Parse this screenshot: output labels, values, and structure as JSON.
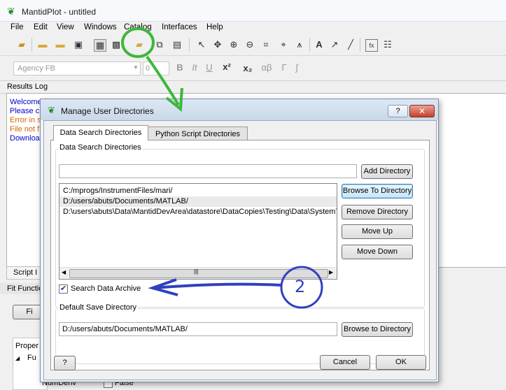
{
  "app": {
    "title": "MantidPlot - untitled"
  },
  "menu": [
    "File",
    "Edit",
    "View",
    "Windows",
    "Catalog",
    "Interfaces",
    "Help"
  ],
  "format_toolbar": {
    "font": "Agency FB",
    "size": "0"
  },
  "results_log": {
    "header": "Results Log",
    "lines": [
      {
        "text": "Welcome",
        "color": "#0000cc"
      },
      {
        "text": "Please cl",
        "color": "#0000cc"
      },
      {
        "text": "Error in s",
        "color": "#e06000"
      },
      {
        "text": "File not f",
        "color": "#e06000"
      },
      {
        "text": "Download",
        "color": "#0000cc"
      }
    ]
  },
  "side_panel": {
    "script_tab": "Script I",
    "fit_header": "Fit Functio",
    "fit_button": "Fi",
    "property_header": "Proper",
    "function_row": "Fu",
    "numderiv_label": "NumDeriv",
    "numderiv_value": "False"
  },
  "dialog": {
    "title": "Manage User Directories",
    "help_label": "?",
    "close_label": "✕",
    "tabs": [
      "Data Search Directories",
      "Python Script Directories"
    ],
    "active_tab": 0,
    "data_search_group": {
      "label": "Data Search Directories",
      "input_value": "",
      "add_button": "Add Directory",
      "directories": [
        "C:/mprogs/InstrumentFiles/mari/",
        "D:/users/abuts/Documents/MATLAB/",
        "D:\\users\\abuts\\Data\\MantidDevArea\\datastore\\DataCopies\\Testing\\Data\\SystemT"
      ],
      "selected_index": 1,
      "browse_button": "Browse To Directory",
      "remove_button": "Remove Directory",
      "move_up_button": "Move Up",
      "move_down_button": "Move Down",
      "search_archive_label": "Search Data Archive",
      "search_archive_checked": true
    },
    "default_save_group": {
      "label": "Default Save Directory",
      "value": "D:/users/abuts/Documents/MATLAB/",
      "browse_button": "Browse to Directory"
    },
    "footer": {
      "help": "?",
      "cancel": "Cancel",
      "ok": "OK"
    }
  },
  "annotation": {
    "number": "2",
    "color_green": "#3cb83c",
    "color_blue": "#3040c0"
  }
}
